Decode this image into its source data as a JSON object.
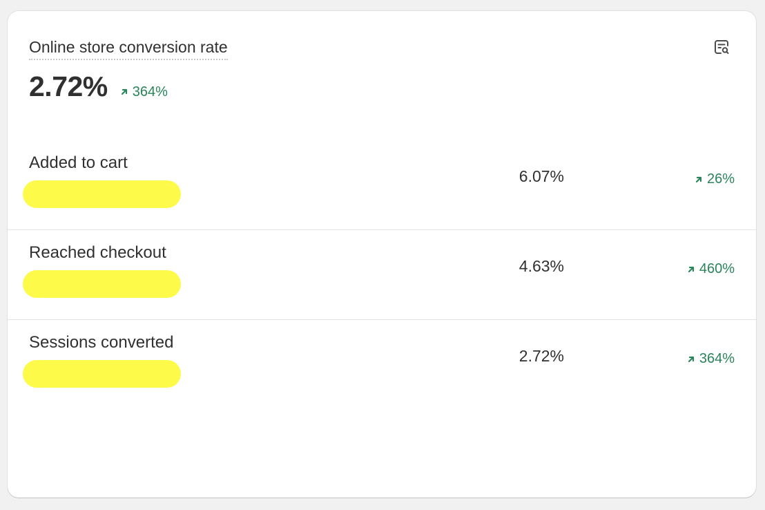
{
  "card": {
    "title": "Online store conversion rate",
    "value": "2.72%",
    "change": "364%",
    "change_direction": "up",
    "icon": "report-search-icon"
  },
  "rows": [
    {
      "label": "Added to cart",
      "value": "6.07%",
      "change": "26%",
      "change_direction": "up"
    },
    {
      "label": "Reached checkout",
      "value": "4.63%",
      "change": "460%",
      "change_direction": "up"
    },
    {
      "label": "Sessions converted",
      "value": "2.72%",
      "change": "364%",
      "change_direction": "up"
    }
  ],
  "colors": {
    "positive": "#29845a",
    "highlight": "#fdfa4a",
    "text": "#303030"
  }
}
